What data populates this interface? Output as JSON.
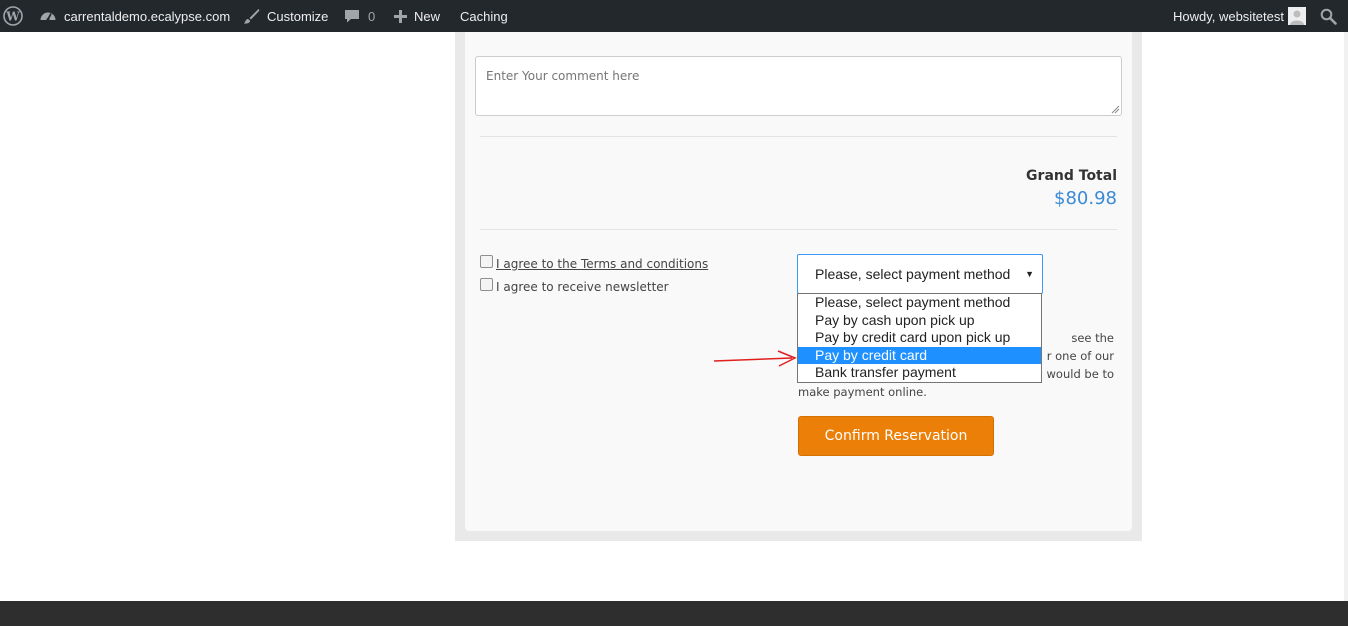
{
  "admin_bar": {
    "site_name": "carrentaldemo.ecalypse.com",
    "customize_label": "Customize",
    "comments_count": "0",
    "new_label": "New",
    "caching_label": "Caching",
    "howdy_label": "Howdy, websitetest"
  },
  "form": {
    "comment_placeholder": "Enter Your comment here",
    "grand_total_label": "Grand Total",
    "grand_total_value": "$80.98",
    "terms_label": "I agree to the Terms and conditions",
    "terms_checked": false,
    "newsletter_label": "I agree to receive newsletter",
    "newsletter_checked": false,
    "payment_select_value": "Please, select payment method",
    "payment_options": [
      "Please, select payment method",
      "Pay by cash upon pick up",
      "Pay by credit card upon pick up",
      "Pay by credit card",
      "Bank transfer payment"
    ],
    "highlighted_option": "Pay by credit card",
    "payment_info_partial": [
      "see the",
      "r one of our",
      "would be to",
      "make payment online."
    ],
    "confirm_label": "Confirm Reservation"
  },
  "colors": {
    "admin_bar_bg": "#23282d",
    "accent_blue": "#3a8ad6",
    "confirm_orange": "#ec7f07",
    "highlight_blue": "#1e90ff",
    "annotation_arrow": "#e02020",
    "footer_bg": "#2e2e2e"
  }
}
